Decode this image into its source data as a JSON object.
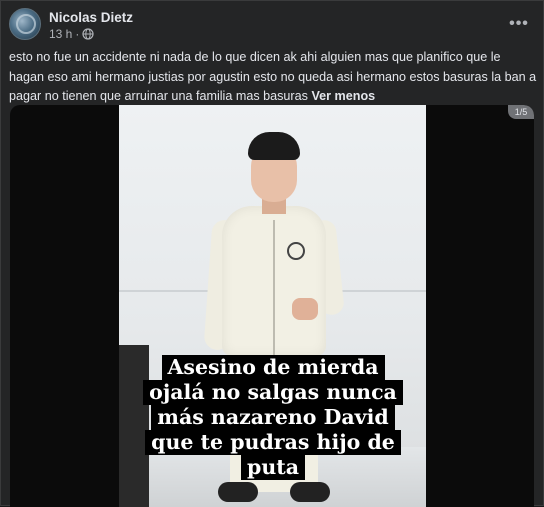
{
  "post": {
    "author": "Nicolas Dietz",
    "time": "13 h",
    "separator": "·",
    "privacy_icon": "globe-icon",
    "more_label": "•••",
    "text": "esto no fue un accidente ni nada de lo que dicen ak ahi alguien mas que planifico que le hagan eso ami hermano justias por agustin esto no queda asi hermano estos basuras la ban a pagar no tienen que arruinar una familia mas basuras",
    "see_less": "Ver menos"
  },
  "media": {
    "counter": "1/5",
    "caption_lines": [
      "Asesino de mierda",
      "ojalá no salgas nunca",
      "más nazareno David",
      "que te pudras hijo de",
      "puta"
    ]
  },
  "colors": {
    "background": "#242526",
    "text": "#e4e6eb",
    "secondary_text": "#b0b3b8"
  }
}
